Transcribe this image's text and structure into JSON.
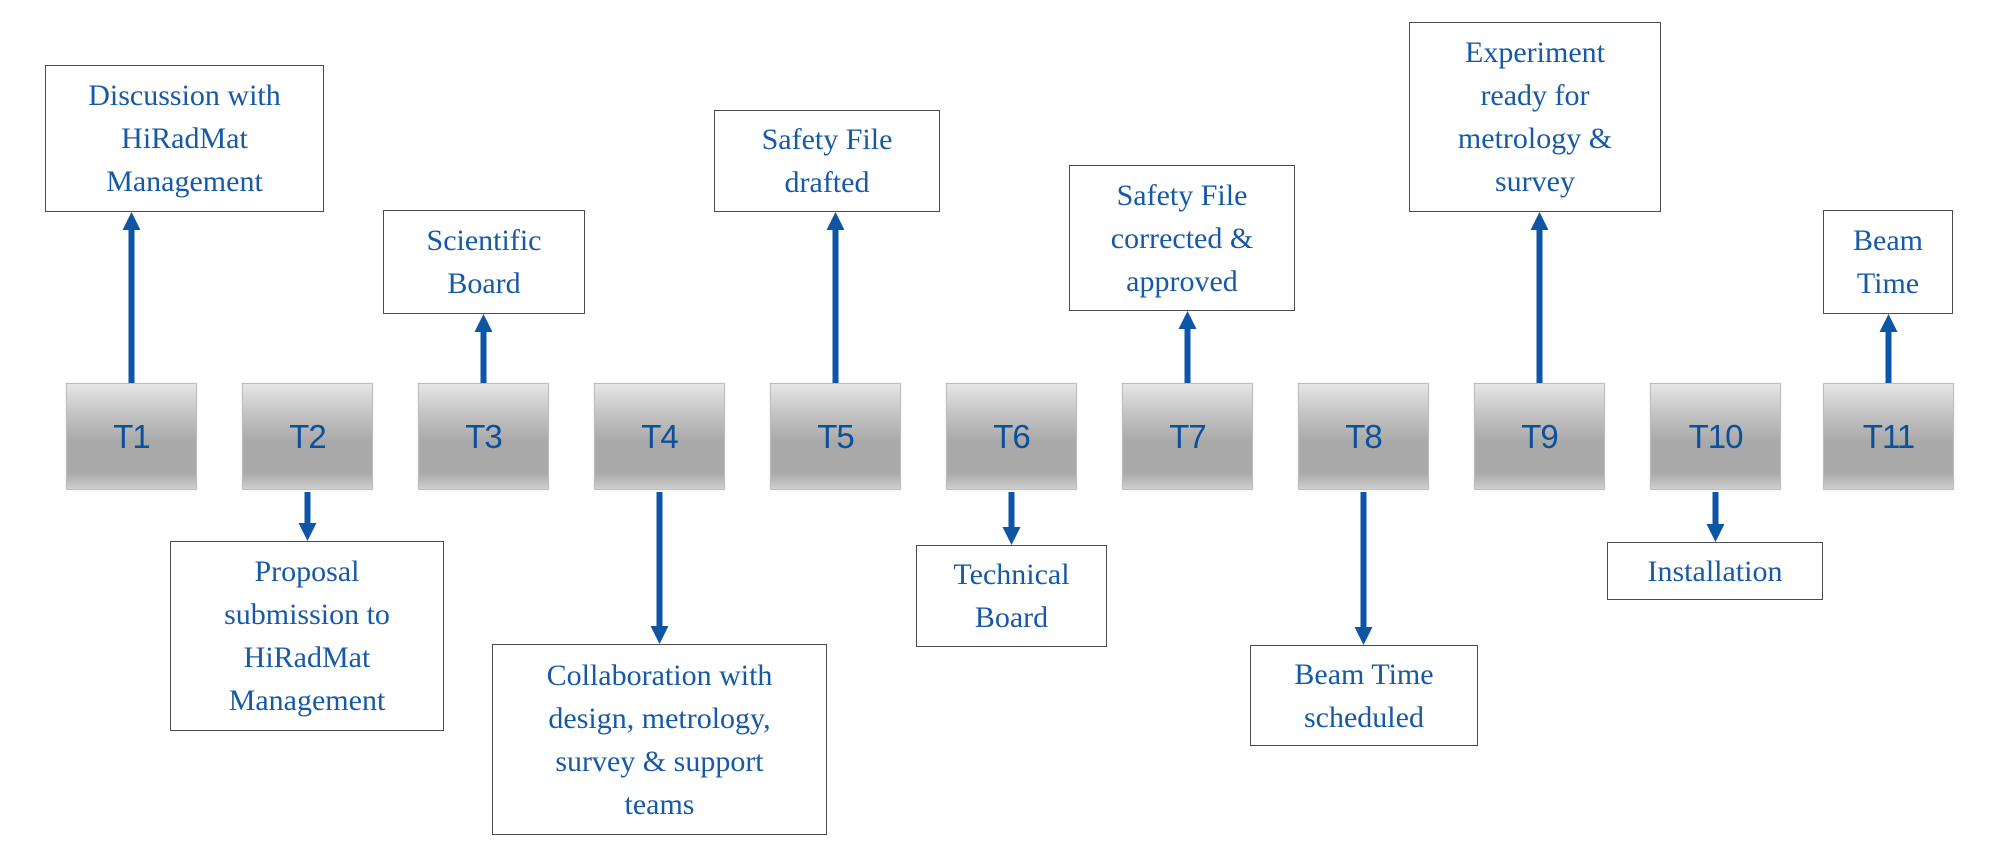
{
  "diagram": {
    "type": "timeline",
    "arrow_color": "#0d56a6",
    "text_color": "#1659a7",
    "steps": [
      {
        "id": "T1",
        "label": "Discussion with\nHiRadMat\nManagement",
        "direction": "up"
      },
      {
        "id": "T2",
        "label": "Proposal\nsubmission to\nHiRadMat\nManagement",
        "direction": "down"
      },
      {
        "id": "T3",
        "label": "Scientific\nBoard",
        "direction": "up"
      },
      {
        "id": "T4",
        "label": "Collaboration with\ndesign, metrology,\nsurvey & support\nteams",
        "direction": "down"
      },
      {
        "id": "T5",
        "label": "Safety File\ndrafted",
        "direction": "up"
      },
      {
        "id": "T6",
        "label": "Technical\nBoard",
        "direction": "down"
      },
      {
        "id": "T7",
        "label": "Safety File\ncorrected &\napproved",
        "direction": "up"
      },
      {
        "id": "T8",
        "label": "Beam Time\nscheduled",
        "direction": "down"
      },
      {
        "id": "T9",
        "label": "Experiment\nready for\nmetrology &\nsurvey",
        "direction": "up"
      },
      {
        "id": "T10",
        "label": "Installation",
        "direction": "down"
      },
      {
        "id": "T11",
        "label": "Beam\nTime",
        "direction": "up"
      }
    ]
  }
}
